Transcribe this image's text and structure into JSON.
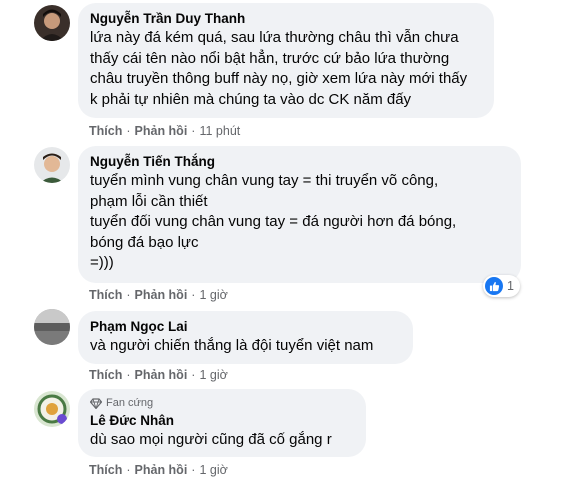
{
  "comments": [
    {
      "author": "Nguyễn Trần Duy Thanh",
      "text": "lứa này đá kém quá, sau lứa thường châu thì vẫn chưa\nthấy cái tên nào nổi bật hẳn, trước cứ bảo lứa thường\nchâu truyền thông buff này nọ, giờ xem lứa này mới thấy\nk phải tự nhiên mà chúng ta vào dc CK năm đấy",
      "like_label": "Thích",
      "reply_label": "Phản hồi",
      "time": "11 phút"
    },
    {
      "author": "Nguyễn Tiến Thắng",
      "text": "tuyển mình vung chân vung tay = thi truyển võ công,\nphạm lỗi cần thiết\ntuyển đối vung chân vung tay = đá người hơn đá bóng,\nbóng đá bạo lực\n=)))",
      "like_label": "Thích",
      "reply_label": "Phản hồi",
      "time": "1 giờ",
      "reaction_count": "1"
    },
    {
      "author": "Phạm Ngọc Lai",
      "text": "và người chiến thắng là đội tuyển việt nam",
      "like_label": "Thích",
      "reply_label": "Phản hồi",
      "time": "1 giờ"
    },
    {
      "badge": "Fan cứng",
      "author": "Lê Đức Nhân",
      "text": "dù sao mọi người cũng đã cố gắng r",
      "like_label": "Thích",
      "reply_label": "Phản hồi",
      "time": "1 giờ"
    }
  ],
  "icons": {
    "reaction": "like-icon",
    "badge": "diamond-icon"
  },
  "colors": {
    "bubble": "#f0f2f5",
    "meta": "#65676b",
    "like": "#1877f2"
  }
}
